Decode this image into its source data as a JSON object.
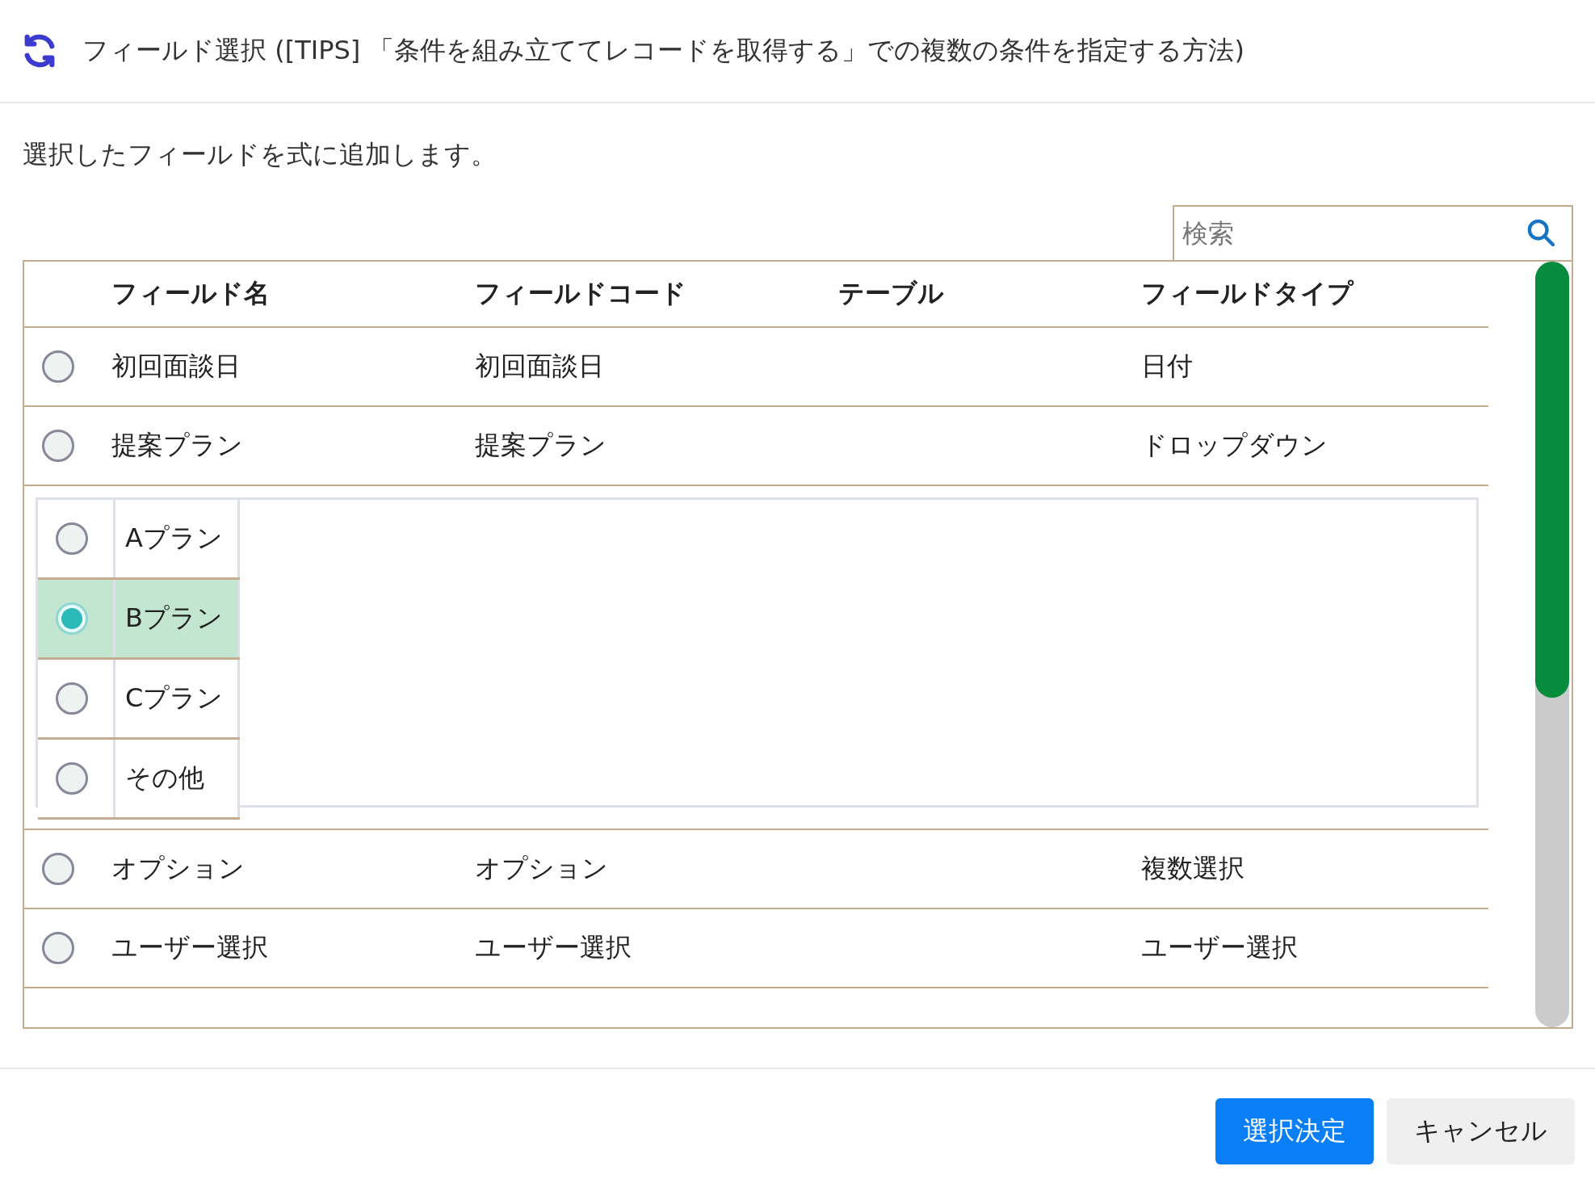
{
  "title": "フィールド選択 ([TIPS] 「条件を組み立ててレコードを取得する」での複数の条件を指定する方法)",
  "description": "選択したフィールドを式に追加します。",
  "search": {
    "placeholder": "検索"
  },
  "columns": [
    "フィールド名",
    "フィールドコード",
    "テーブル",
    "フィールドタイプ"
  ],
  "rows": [
    {
      "name": "初回面談日",
      "code": "初回面談日",
      "type": "日付",
      "selected": false
    },
    {
      "name": "提案プラン",
      "code": "提案プラン",
      "type": "ドロップダウン",
      "selected": false,
      "expanded": true,
      "options": [
        {
          "label": "Aプラン",
          "selected": false
        },
        {
          "label": "Bプラン",
          "selected": true
        },
        {
          "label": "Cプラン",
          "selected": false
        },
        {
          "label": "その他",
          "selected": false
        }
      ]
    },
    {
      "name": "オプション",
      "code": "オプション",
      "type": "複数選択",
      "selected": false
    },
    {
      "name": "ユーザー選択",
      "code": "ユーザー選択",
      "type": "ユーザー選択",
      "selected": false
    }
  ],
  "buttons": [
    {
      "label": "選択決定",
      "kind": "primary"
    },
    {
      "label": "キャンセル",
      "kind": "secondary"
    }
  ]
}
